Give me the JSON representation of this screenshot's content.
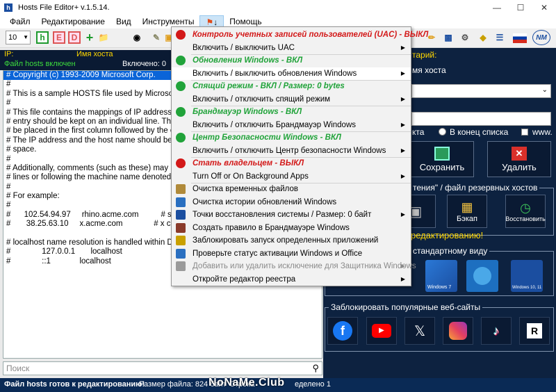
{
  "window": {
    "title": "Hosts File Editor+ v.1.5.14."
  },
  "menu": [
    "Файл",
    "Редактирование",
    "Вид",
    "Инструменты",
    "Помощь"
  ],
  "toolbar": {
    "font_size": "10"
  },
  "left": {
    "ip_label": "IP:",
    "host_label": "Имя хоста",
    "status": "Файл hosts включен",
    "enabled": "Включено: 0",
    "search_placeholder": "Поиск",
    "lines": [
      "# Copyright (c) 1993-2009 Microsoft Corp.",
      "#",
      "# This is a sample HOSTS file used by Microsof",
      "#",
      "# This file contains the mappings of IP addresse",
      "# entry should be kept on an individual line. The",
      "# be placed in the first column followed by the co",
      "# The IP address and the host name should be s",
      "# space.",
      "#",
      "# Additionally, comments (such as these) may b",
      "# lines or following the machine name denoted b",
      "#",
      "# For example:",
      "#",
      "#      102.54.94.97     rhino.acme.com          # sourc",
      "#       38.25.63.10     x.acme.com              # x client h",
      "",
      "# localhost name resolution is handled within DN",
      "#              127.0.0.1       localhost",
      "#              ::1             localhost"
    ]
  },
  "right": {
    "comment_label": "тарий:",
    "host_name_label": "мя хоста",
    "radio_end": "В конец списка",
    "radio_start_tail": "кта",
    "www": "www.",
    "save": "Сохранить",
    "delete": "Удалить",
    "backup_group": "тения\" / файл резервных хостов",
    "backup": "Бэкап",
    "restore": "Восстановить",
    "edit_mode": "редактированию!",
    "std_group": "стандартному виду",
    "win7": "Windows 7",
    "win10": "Windows 10, 11",
    "block_group": "Заблокировать популярные веб-сайты"
  },
  "dropdown": {
    "items": [
      {
        "label": "Контроль учетных записей пользователей (UAC) - ВЫКЛ",
        "kind": "hdr red"
      },
      {
        "label": "Включить / выключить UAC",
        "kind": "sub"
      },
      {
        "label": "Обновления Windows - ВКЛ",
        "kind": "hdr green"
      },
      {
        "label": "Включить / выключить обновления Windows",
        "kind": "sub hl"
      },
      {
        "label": "Спящий режим - ВКЛ / Размер: 0 bytes",
        "kind": "hdr green"
      },
      {
        "label": "Включить / отключить спящий режим",
        "kind": "sub"
      },
      {
        "label": "Брандмауэр Windows - ВКЛ",
        "kind": "hdr green"
      },
      {
        "label": "Включить / отключить Брандмауэр Windows",
        "kind": "sub"
      },
      {
        "label": "Центр Безопасности Windows - ВКЛ",
        "kind": "hdr green"
      },
      {
        "label": "Включить / отключить Центр безопасности Windows",
        "kind": "sub"
      },
      {
        "label": "Стать владельцем - ВЫКЛ",
        "kind": "hdr red"
      },
      {
        "label": "Turn Off or On Background Apps",
        "kind": "sub"
      },
      {
        "label": "Очистка временных файлов",
        "kind": ""
      },
      {
        "label": "Очистка истории обновлений Windows",
        "kind": ""
      },
      {
        "label": "Точки восстановления системы / Размер: 0 байт",
        "kind": "sub"
      },
      {
        "label": "Создать правило в Брандмауэре Windows",
        "kind": ""
      },
      {
        "label": "Заблокировать запуск определенных приложений",
        "kind": ""
      },
      {
        "label": "Проверьте статус активации Windows и Office",
        "kind": ""
      },
      {
        "label": "Добавить или удалить исключение для Защитника Windows",
        "kind": "sub dis"
      },
      {
        "label": "Откройте редактор реестра",
        "kind": "sub"
      }
    ]
  },
  "statusbar": {
    "ready": "Файл hosts готов к редактированию!",
    "size": "Размер файла:  824 байт",
    "line": "Строка",
    "sel": "еделено 1"
  },
  "watermark": "NoNaMe.Club",
  "colors": {
    "panel": "#0d2240",
    "accent_red": "#d31919",
    "accent_green": "#21a33a"
  }
}
